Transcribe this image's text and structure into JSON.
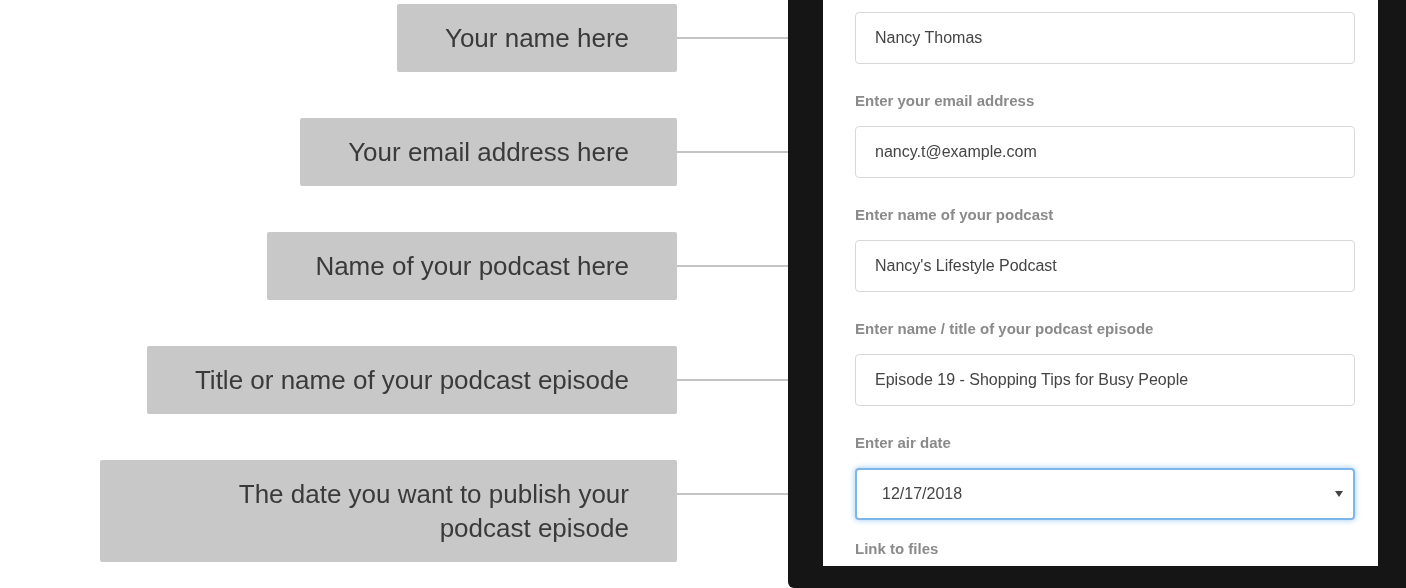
{
  "callouts": [
    "Your name here",
    "Your email address here",
    "Name of your podcast here",
    "Title or name of your podcast episode",
    "The date you want to publish your podcast episode"
  ],
  "form": {
    "fields": [
      {
        "kind": "text",
        "value": "Nancy Thomas",
        "focused": false
      },
      {
        "kind": "text",
        "label": "Enter your email address",
        "value": "nancy.t@example.com",
        "focused": false
      },
      {
        "kind": "text",
        "label": "Enter name of your podcast",
        "value": "Nancy's Lifestyle Podcast",
        "focused": false
      },
      {
        "kind": "text",
        "label": "Enter name / title of your podcast episode",
        "value": "Episode 19 - Shopping Tips for Busy People",
        "focused": false
      },
      {
        "kind": "select",
        "label": "Enter air date",
        "value": "12/17/2018",
        "focused": true
      }
    ],
    "next_label": "Link to files"
  }
}
